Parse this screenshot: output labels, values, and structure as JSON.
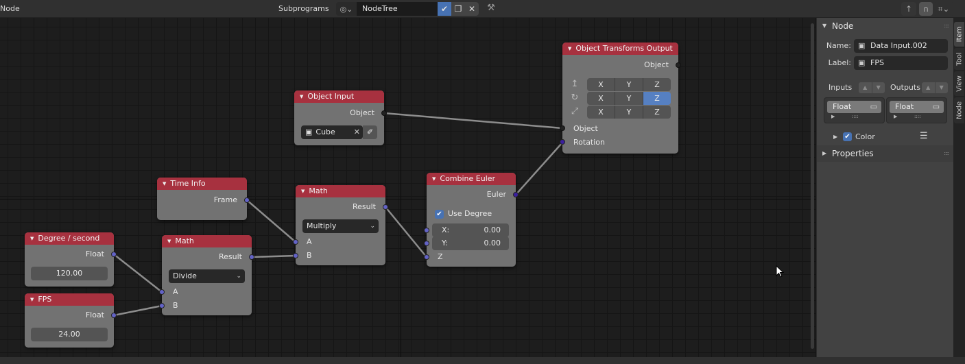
{
  "header": {
    "editor_name": "Node",
    "subprograms_label": "Subprograms",
    "datablock": {
      "type_icon": "node-tree-icon",
      "name": "NodeTree",
      "fake_user_active": true
    }
  },
  "nodes": {
    "object_input": {
      "title": "Object Input",
      "output_label": "Object",
      "object_value": "Cube"
    },
    "object_transforms_output": {
      "title": "Object Transforms Output",
      "output_label": "Object",
      "rows": [
        {
          "icon": "location-icon",
          "axes": [
            "X",
            "Y",
            "Z"
          ],
          "enabled": [
            false,
            false,
            false
          ]
        },
        {
          "icon": "rotation-icon",
          "axes": [
            "X",
            "Y",
            "Z"
          ],
          "enabled": [
            false,
            false,
            true
          ]
        },
        {
          "icon": "scale-icon",
          "axes": [
            "X",
            "Y",
            "Z"
          ],
          "enabled": [
            false,
            false,
            false
          ]
        }
      ],
      "inputs": [
        "Object",
        "Rotation"
      ]
    },
    "time_info": {
      "title": "Time Info",
      "output_label": "Frame"
    },
    "math_multiply": {
      "title": "Math",
      "output_label": "Result",
      "operation": "Multiply",
      "inputs": [
        "A",
        "B"
      ]
    },
    "combine_euler": {
      "title": "Combine Euler",
      "output_label": "Euler",
      "use_degree_label": "Use Degree",
      "use_degree": true,
      "x_label": "X:",
      "x_value": "0.00",
      "y_label": "Y:",
      "y_value": "0.00",
      "z_label": "Z"
    },
    "degree_per_second": {
      "title": "Degree / second",
      "output_label": "Float",
      "value": "120.00"
    },
    "fps": {
      "title": "FPS",
      "output_label": "Float",
      "value": "24.00"
    },
    "math_divide": {
      "title": "Math",
      "output_label": "Result",
      "operation": "Divide",
      "inputs": [
        "A",
        "B"
      ]
    }
  },
  "sidebar": {
    "tabs": [
      "Item",
      "Tool",
      "View",
      "Node"
    ],
    "active_tab": "Item",
    "node_panel": {
      "title": "Node",
      "name_label": "Name:",
      "name_value": "Data Input.002",
      "label_label": "Label:",
      "label_value": "FPS",
      "inputs_label": "Inputs",
      "outputs_label": "Outputs",
      "inputs_item": "Float",
      "outputs_item": "Float",
      "color_label": "Color",
      "color_enabled": true
    },
    "properties_panel": {
      "title": "Properties"
    }
  },
  "colors": {
    "node_header": "#a7313f",
    "node_body": "#727272",
    "socket_float": "#6363c7",
    "accent_blue": "#4772b3"
  }
}
